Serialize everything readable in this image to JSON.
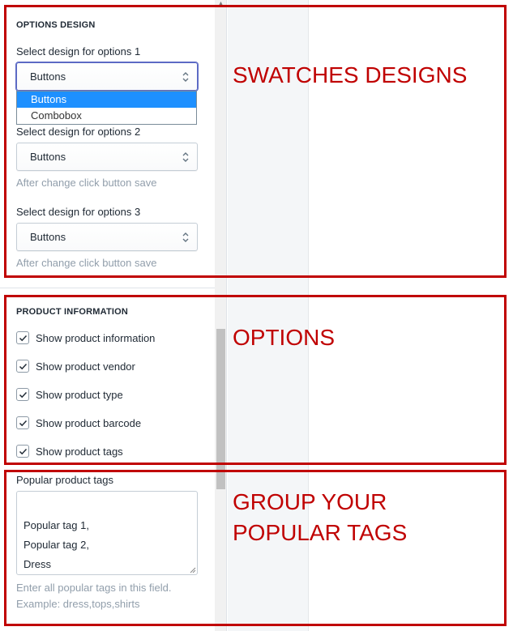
{
  "options_design": {
    "title": "OPTIONS DESIGN",
    "option1_label": "Select design for options 1",
    "option1_value": "Buttons",
    "dropdown_options": [
      "Buttons",
      "Combobox"
    ],
    "option2_label": "Select design for options 2",
    "option2_value": "Buttons",
    "option2_help": "After change click button save",
    "option3_label": "Select design for options 3",
    "option3_value": "Buttons",
    "option3_help": "After change click button save"
  },
  "product_information": {
    "title": "PRODUCT INFORMATION",
    "checkboxes": [
      {
        "label": "Show product information",
        "checked": true
      },
      {
        "label": "Show product vendor",
        "checked": true
      },
      {
        "label": "Show product type",
        "checked": true
      },
      {
        "label": "Show product barcode",
        "checked": true
      },
      {
        "label": "Show product tags",
        "checked": true
      }
    ]
  },
  "popular_tags": {
    "label": "Popular product tags",
    "value": "Popular tag 1,\nPopular tag 2,\nDress",
    "help_line1": "Enter all popular tags in this field.",
    "help_line2": "Example: dress,tops,shirts"
  },
  "annotations": {
    "swatches": "SWATCHES DESIGNS",
    "options": "OPTIONS",
    "group_line1": "GROUP YOUR",
    "group_line2": "POPULAR TAGS",
    "color": "#c00000"
  }
}
